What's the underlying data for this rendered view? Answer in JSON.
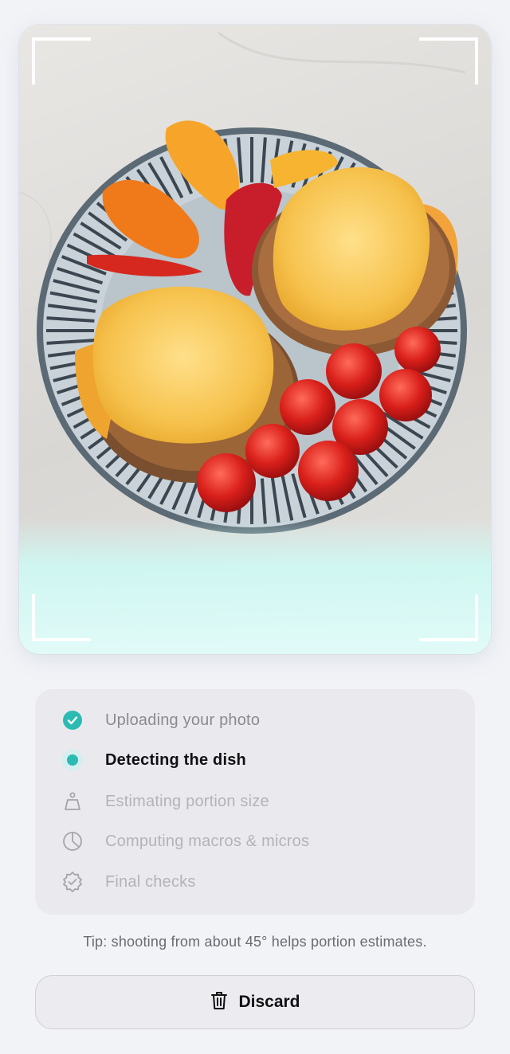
{
  "photo": {
    "description_icon": "food-photo",
    "scan_color": "#cdfaf4"
  },
  "steps": [
    {
      "label": "Uploading your photo",
      "status": "done",
      "icon": "check-circle-icon"
    },
    {
      "label": "Detecting the dish",
      "status": "active",
      "icon": "dot-icon"
    },
    {
      "label": "Estimating portion size",
      "status": "pending",
      "icon": "scale-icon"
    },
    {
      "label": "Computing macros & micros",
      "status": "pending",
      "icon": "pie-chart-icon"
    },
    {
      "label": "Final checks",
      "status": "pending",
      "icon": "badge-check-icon"
    }
  ],
  "tip": "Tip: shooting from about 45° helps portion estimates.",
  "discard_button": {
    "label": "Discard",
    "icon": "trash-icon"
  },
  "colors": {
    "accent": "#2bbbb3",
    "background": "#f2f3f7"
  }
}
